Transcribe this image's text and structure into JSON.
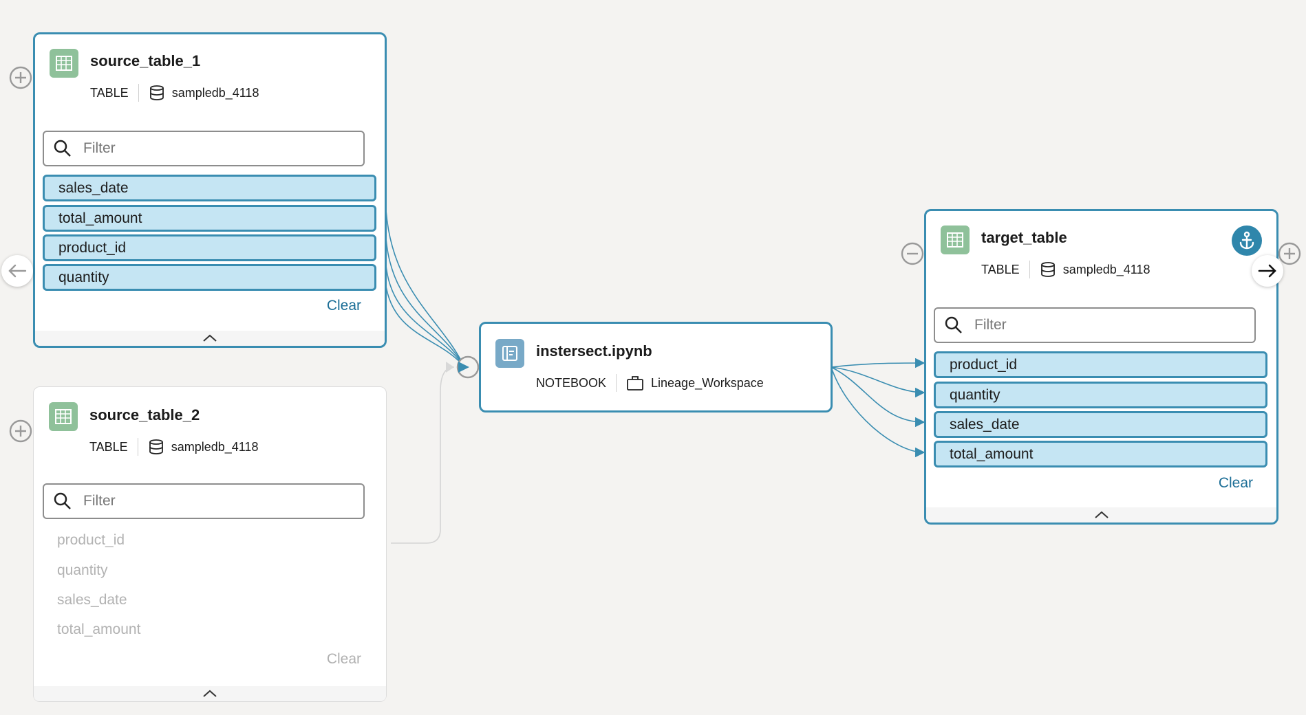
{
  "nodes": {
    "source1": {
      "title": "source_table_1",
      "type": "TABLE",
      "database": "sampledb_4118",
      "filter_placeholder": "Filter",
      "columns": [
        "sales_date",
        "total_amount",
        "product_id",
        "quantity"
      ],
      "clear_label": "Clear"
    },
    "source2": {
      "title": "source_table_2",
      "type": "TABLE",
      "database": "sampledb_4118",
      "filter_placeholder": "Filter",
      "columns": [
        "product_id",
        "quantity",
        "sales_date",
        "total_amount"
      ],
      "clear_label": "Clear"
    },
    "notebook": {
      "title": "instersect.ipynb",
      "type": "NOTEBOOK",
      "workspace": "Lineage_Workspace"
    },
    "target": {
      "title": "target_table",
      "type": "TABLE",
      "database": "sampledb_4118",
      "filter_placeholder": "Filter",
      "columns": [
        "product_id",
        "quantity",
        "sales_date",
        "total_amount"
      ],
      "clear_label": "Clear"
    }
  },
  "icons": {
    "table": "table-grid-icon",
    "notebook": "notebook-icon",
    "database": "database-icon",
    "workspace": "briefcase-icon",
    "search": "search-icon",
    "anchor": "anchor-icon"
  },
  "colors": {
    "accent": "#3a8db1",
    "selected_column": "#c5e5f3",
    "table_icon": "#8fc19a",
    "notebook_icon": "#78a9c7",
    "link": "#1c6e96"
  }
}
